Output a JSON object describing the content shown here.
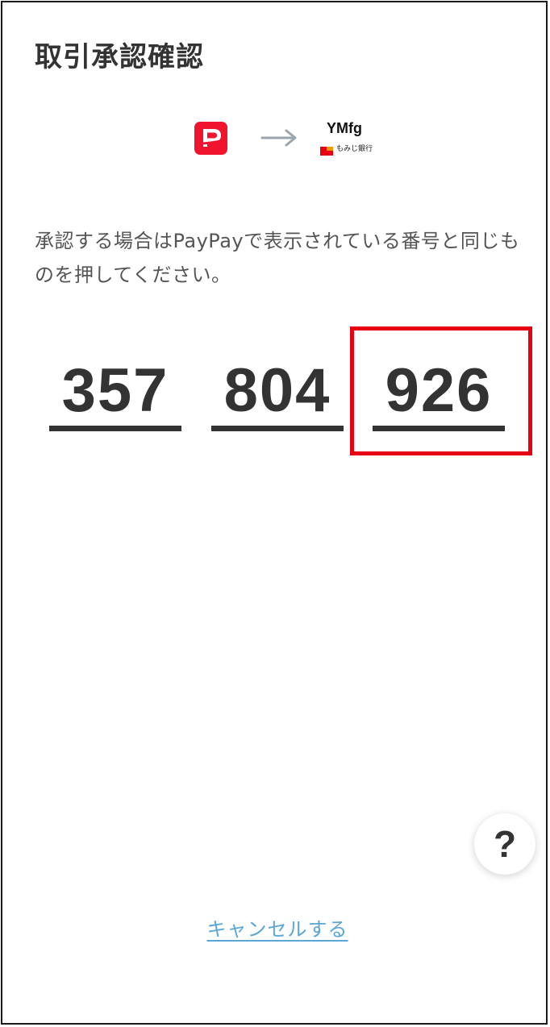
{
  "header": {
    "title": "取引承認確認"
  },
  "logos": {
    "source_icon": "paypay-logo",
    "arrow_icon": "arrow-right-icon",
    "target": {
      "brand": "YMfg",
      "bank_name": "もみじ銀行"
    }
  },
  "instruction": "承認する場合はPayPayで表示されている番号と同じものを押してください。",
  "numbers": [
    {
      "value": "357",
      "selected": false
    },
    {
      "value": "804",
      "selected": false
    },
    {
      "value": "926",
      "selected": true
    }
  ],
  "help": {
    "label": "?"
  },
  "cancel": {
    "label": "キャンセルする"
  },
  "colors": {
    "paypay_red": "#f0142e",
    "highlight_red": "#e60012",
    "link_blue": "#5aa6d8",
    "text_dark": "#333333"
  }
}
